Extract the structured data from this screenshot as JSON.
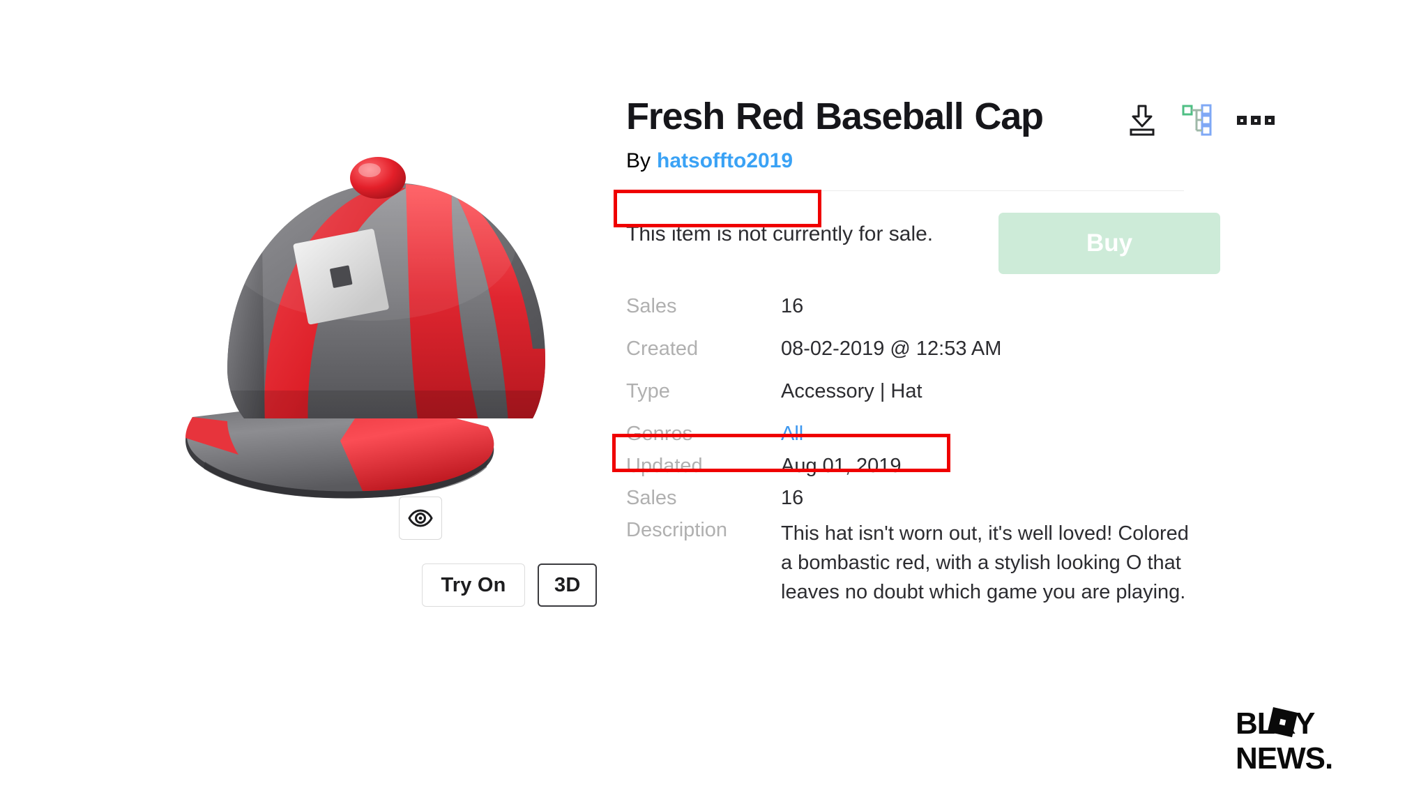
{
  "item": {
    "title": "Fresh Red Baseball Cap",
    "byline_prefix": "By",
    "creator": "hatsoffto2019",
    "sale_status": "This item is not currently for sale.",
    "buy_label": "Buy"
  },
  "viewer": {
    "eye_icon": "eye-icon",
    "try_on_label": "Try On",
    "three_d_label": "3D"
  },
  "actions": {
    "download_icon": "download-icon",
    "tree_icon": "hierarchy-tree-icon",
    "more_icon": "more-options-icon"
  },
  "specs": [
    {
      "label": "Sales",
      "value": "16",
      "type": "text"
    },
    {
      "label": "Created",
      "value": "08-02-2019 @ 12:53 AM",
      "type": "text"
    },
    {
      "label": "Type",
      "value": "Accessory | Hat",
      "type": "text"
    },
    {
      "label": "Genres",
      "value": "All",
      "type": "link"
    },
    {
      "label": "Updated",
      "value": "Aug 01, 2019",
      "type": "text"
    },
    {
      "label": "Sales",
      "value": "16",
      "type": "text"
    },
    {
      "label": "Description",
      "value": "This hat isn't worn out, it's well loved! Colored a bombastic red, with a stylish looking O that leaves no doubt which game you are playing.",
      "type": "text"
    }
  ],
  "watermark": {
    "line1": "BLXY",
    "line2": "NEWS."
  },
  "colors": {
    "creator_link": "#3aa2f5",
    "genre_link": "#3d97ef",
    "buy_button_bg": "#cdebd8",
    "annotation_red": "#ef0000",
    "label_gray": "#b0b0b0",
    "hat_red": "#e8252e",
    "hat_gray": "#6e6e72"
  }
}
